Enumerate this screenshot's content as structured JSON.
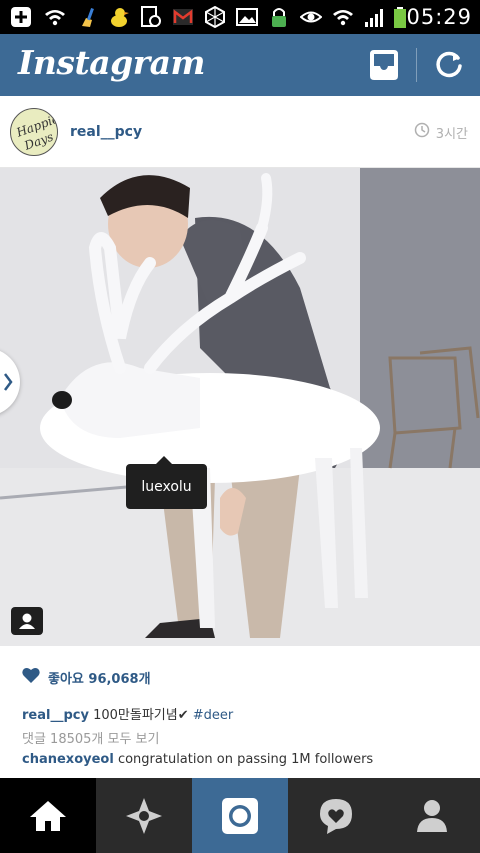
{
  "status_bar": {
    "time": "05:29"
  },
  "app_bar": {
    "title": "Instagram"
  },
  "post": {
    "username": "real__pcy",
    "time_ago": "3시간",
    "tagged_user": "luexolu",
    "likes_text": "좋아요 96,068개",
    "caption_user": "real__pcy",
    "caption_text": "100만돌파기념✔",
    "caption_hashtag": "#deer",
    "view_all_comments": "댓글 18505개 모두 보기",
    "comment_user": "chanexoyeol",
    "comment_text": "congratulation on passing 1M followers"
  },
  "colors": {
    "brand": "#3d6a95",
    "link": "#2f5a86",
    "nav_bg": "#2b2b2b",
    "nav_active": "#3d6a95"
  },
  "bottom_nav": {
    "items": [
      {
        "name": "home-icon"
      },
      {
        "name": "explore-icon"
      },
      {
        "name": "camera-icon"
      },
      {
        "name": "news-icon"
      },
      {
        "name": "profile-icon"
      }
    ]
  }
}
